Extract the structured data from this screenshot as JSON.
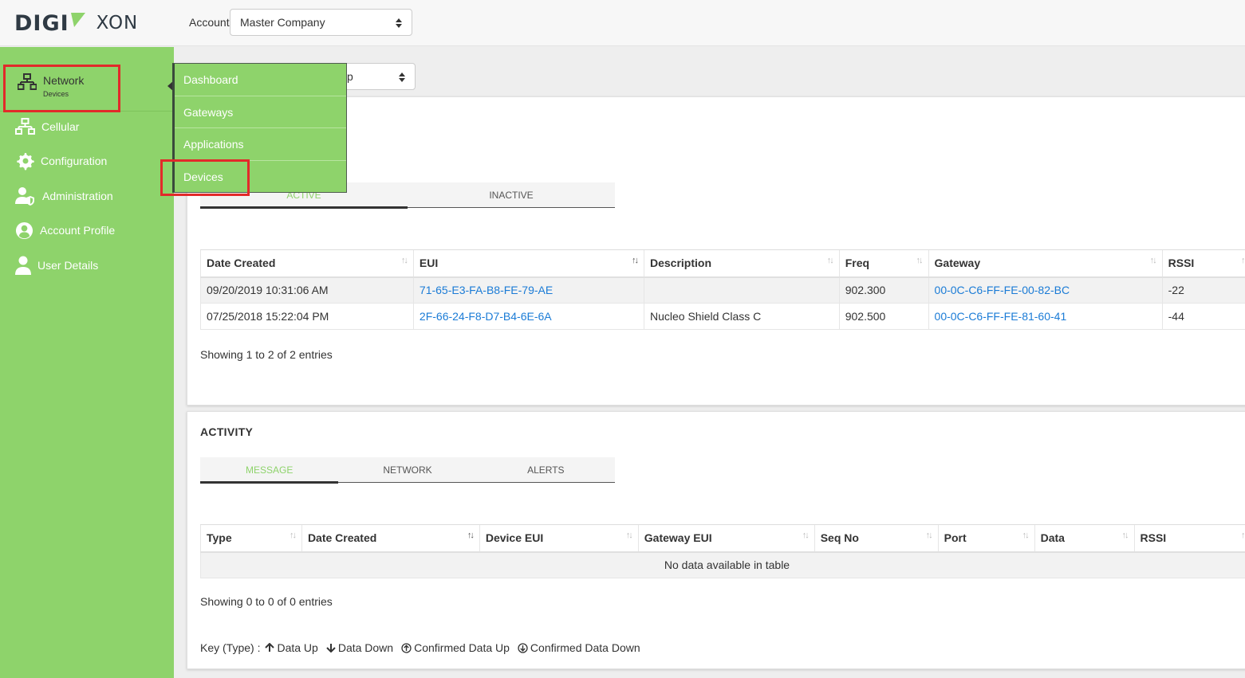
{
  "header": {
    "logo_text_1": "DIGI",
    "logo_text_2": "XON",
    "account_label": "Account",
    "account_value": "Master Company"
  },
  "sidebar": {
    "active": {
      "label": "Network",
      "sub": "Devices"
    },
    "items": [
      {
        "label": "Cellular",
        "icon": "network-icon"
      },
      {
        "label": "Configuration",
        "icon": "gear-icon"
      },
      {
        "label": "Administration",
        "icon": "admin-user-icon"
      },
      {
        "label": "Account Profile",
        "icon": "account-circle-icon"
      },
      {
        "label": "User Details",
        "icon": "user-icon"
      }
    ]
  },
  "flyout": {
    "items": [
      "Dashboard",
      "Gateways",
      "Applications",
      "Devices"
    ]
  },
  "sub_select_fragment": "p",
  "devices": {
    "tabs": [
      "ACTIVE",
      "INACTIVE"
    ],
    "active_tab": "ACTIVE",
    "columns": [
      "Date Created",
      "EUI",
      "Description",
      "Freq",
      "Gateway",
      "RSSI"
    ],
    "rows": [
      {
        "date": "09/20/2019 10:31:06 AM",
        "eui": "71-65-E3-FA-B8-FE-79-AE",
        "description": "",
        "freq": "902.300",
        "gateway": "00-0C-C6-FF-FE-00-82-BC",
        "rssi": "-22"
      },
      {
        "date": "07/25/2018 15:22:04 PM",
        "eui": "2F-66-24-F8-D7-B4-6E-6A",
        "description": "Nucleo Shield Class C",
        "freq": "902.500",
        "gateway": "00-0C-C6-FF-FE-81-60-41",
        "rssi": "-44"
      }
    ],
    "showing": "Showing 1 to 2 of 2 entries"
  },
  "activity": {
    "title": "ACTIVITY",
    "tabs": [
      "MESSAGE",
      "NETWORK",
      "ALERTS"
    ],
    "active_tab": "MESSAGE",
    "columns": [
      "Type",
      "Date Created",
      "Device EUI",
      "Gateway EUI",
      "Seq No",
      "Port",
      "Data",
      "RSSI"
    ],
    "empty_text": "No data available in table",
    "showing": "Showing 0 to 0 of 0 entries",
    "key_label": "Key (Type) :",
    "key_items": [
      "Data Up",
      "Data Down",
      "Confirmed Data Up",
      "Confirmed Data Down"
    ]
  },
  "colors": {
    "sidebar": "#8ed36b",
    "accent_green": "#8ed36b",
    "link": "#1a7bd6",
    "highlight": "#e22a2a"
  }
}
